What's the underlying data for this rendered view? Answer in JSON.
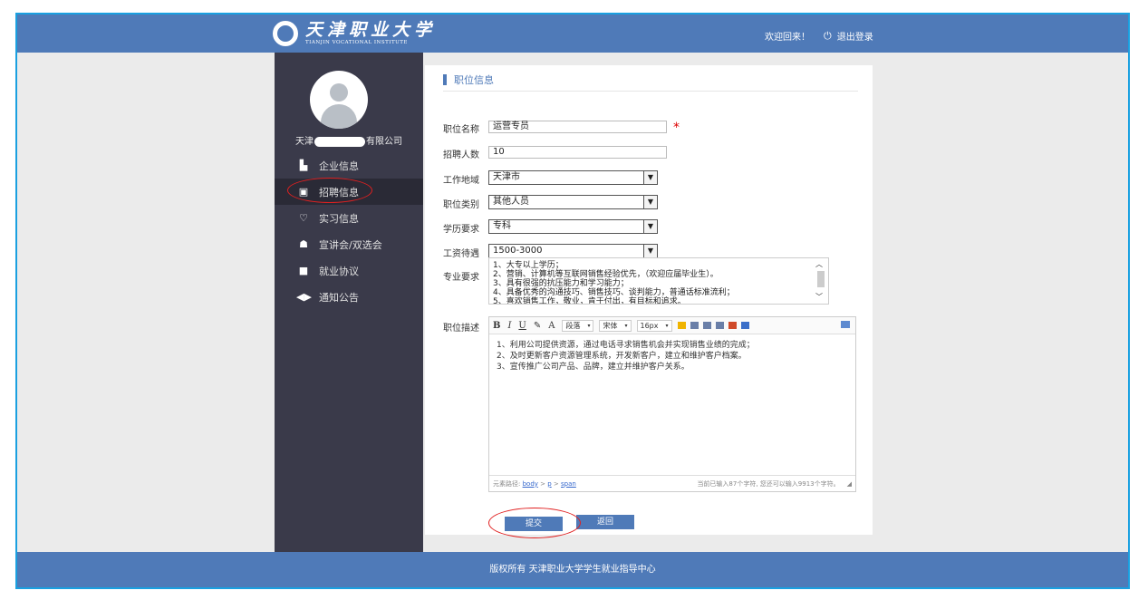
{
  "header": {
    "logo_cn": "天津职业大学",
    "logo_en": "TIANJIN VOCATIONAL INSTITUTE",
    "welcome": "欢迎回来！",
    "logout": "退出登录"
  },
  "sidebar": {
    "company_prefix": "天津",
    "company_suffix": "有限公司",
    "items": [
      {
        "label": "企业信息",
        "icon": "building-icon"
      },
      {
        "label": "招聘信息",
        "icon": "id-card-icon"
      },
      {
        "label": "实习信息",
        "icon": "handshake-icon"
      },
      {
        "label": "宣讲会/双选会",
        "icon": "group-icon"
      },
      {
        "label": "就业协议",
        "icon": "document-icon"
      },
      {
        "label": "通知公告",
        "icon": "megaphone-icon"
      }
    ]
  },
  "form": {
    "section_title": "职位信息",
    "name_label": "职位名称",
    "name_value": "运营专员",
    "count_label": "招聘人数",
    "count_value": "10",
    "location_label": "工作地域",
    "location_value": "天津市",
    "category_label": "职位类别",
    "category_value": "其他人员",
    "education_label": "学历要求",
    "education_value": "专科",
    "salary_label": "工资待遇",
    "salary_value": "1500-3000",
    "major_label": "专业要求",
    "major_lines": [
      "1、大专以上学历；",
      "2、营销、计算机等互联网销售经验优先，（欢迎应届毕业生）。",
      "3、具有很强的抗压能力和学习能力；",
      "4、具备优秀的沟通技巧、销售技巧、谈判能力，普通话标准流利；",
      "5、喜欢销售工作，敬业，肯于付出，有目标和追求。"
    ],
    "desc_label": "职位描述",
    "toolbar": {
      "bold": "B",
      "italic": "I",
      "underline": "U",
      "font_color": "A",
      "paragraph": "段落",
      "font": "宋体",
      "size": "16px"
    },
    "desc_lines": [
      "1、利用公司提供资源，通过电话寻求销售机会并实现销售业绩的完成；",
      "2、及时更新客户资源管理系统，开发新客户，建立和维护客户档案。",
      "3、宣传推广公司产品、品牌，建立并维护客户关系。"
    ],
    "path_label": "元素路径:",
    "path_items": [
      "body",
      "p",
      "span"
    ],
    "char_count": "当前已输入87个字符, 您还可以输入9913个字符。",
    "submit": "提交",
    "back": "返回"
  },
  "footer": {
    "text": "版权所有 天津职业大学学生就业指导中心"
  },
  "colors": {
    "brand": "#4f7ab8",
    "sidebar": "#3a3a4a",
    "required": "#d00000",
    "annotation": "#e02020"
  }
}
